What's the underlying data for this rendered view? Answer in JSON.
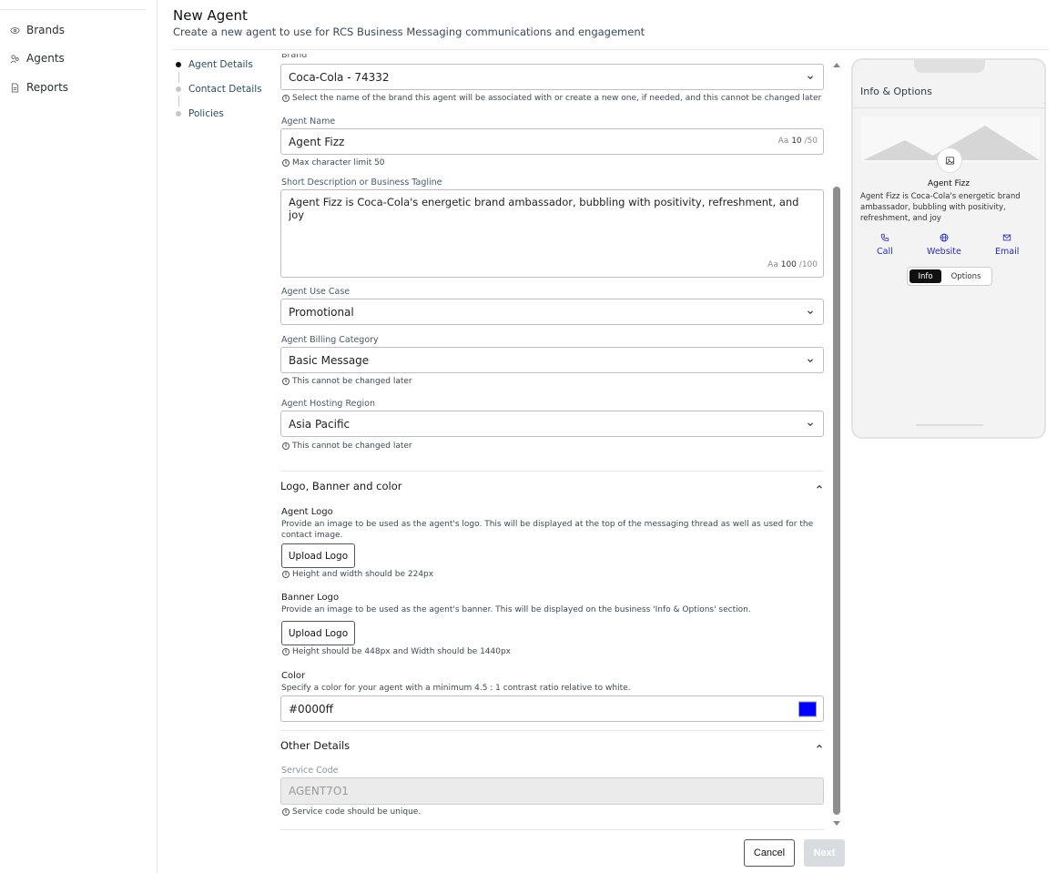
{
  "sidebar": {
    "items": [
      {
        "label": "Brands",
        "icon": "eye-icon"
      },
      {
        "label": "Agents",
        "icon": "users-icon"
      },
      {
        "label": "Reports",
        "icon": "document-icon"
      }
    ]
  },
  "header": {
    "title": "New Agent",
    "subtitle": "Create a new agent to use for RCS Business Messaging communications and engagement"
  },
  "steps": [
    {
      "label": "Agent Details",
      "active": true
    },
    {
      "label": "Contact Details",
      "active": false
    },
    {
      "label": "Policies",
      "active": false
    }
  ],
  "form": {
    "brand": {
      "label": "Brand",
      "value": "Coca-Cola - 74332",
      "hint": "Select the name of the brand this agent will be associated with or create a new one, if needed, and this cannot be changed later"
    },
    "agent_name": {
      "label": "Agent Name",
      "value": "Agent Fizz",
      "counter_prefix": "Aa",
      "counter_current": "10",
      "counter_max": "/50",
      "hint": "Max character limit 50"
    },
    "description": {
      "label": "Short Description or Business Tagline",
      "value": "Agent Fizz is Coca-Cola's energetic brand ambassador, bubbling with positivity, refreshment, and joy",
      "counter_prefix": "Aa",
      "counter_current": "100",
      "counter_max": "/100"
    },
    "use_case": {
      "label": "Agent Use Case",
      "value": "Promotional"
    },
    "billing": {
      "label": "Agent Billing Category",
      "value": "Basic Message",
      "hint": "This cannot be changed later"
    },
    "region": {
      "label": "Agent Hosting Region",
      "value": "Asia Pacific",
      "hint": "This cannot be changed later"
    }
  },
  "logo_section": {
    "title": "Logo, Banner and color",
    "agent_logo": {
      "title": "Agent Logo",
      "desc": "Provide an image to be used as the agent's logo. This will be displayed at the top of the messaging thread as well as used for the contact image.",
      "button": "Upload Logo",
      "hint": "Height and width should be 224px"
    },
    "banner_logo": {
      "title": "Banner Logo",
      "desc": "Provide an image to be used as the agent's banner. This will be displayed on the business 'Info & Options' section.",
      "button": "Upload Logo",
      "hint": "Height should be 448px and Width should be 1440px"
    },
    "color": {
      "title": "Color",
      "desc": "Specify a color for your agent with a minimum 4.5 : 1 contrast ratio relative to white.",
      "value": "#0000ff",
      "swatch": "#0000ff"
    }
  },
  "other_section": {
    "title": "Other Details",
    "service_code": {
      "label": "Service Code",
      "value": "AGENT7O1",
      "hint": "Service code should be unique."
    }
  },
  "footer": {
    "cancel": "Cancel",
    "next": "Next"
  },
  "preview": {
    "title": "Info & Options",
    "agent_name": "Agent Fizz",
    "agent_desc": "Agent Fizz is Coca-Cola's energetic brand ambassador, bubbling with positivity, refreshment, and joy",
    "actions": [
      {
        "label": "Call",
        "icon": "phone-icon"
      },
      {
        "label": "Website",
        "icon": "globe-icon"
      },
      {
        "label": "Email",
        "icon": "mail-icon"
      }
    ],
    "tabs": {
      "info": "Info",
      "options": "Options"
    }
  },
  "colors": {
    "accent": "#0000ff",
    "link": "#2b2bbd"
  }
}
